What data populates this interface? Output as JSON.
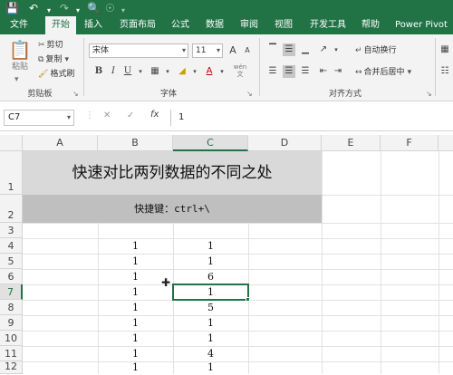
{
  "quick_access": {
    "save_icon": "save-icon",
    "undo_icon": "undo-icon",
    "redo_icon": "redo-icon",
    "preview_icon": "print-preview-icon"
  },
  "tabs": [
    "文件",
    "开始",
    "插入",
    "页面布局",
    "公式",
    "数据",
    "审阅",
    "视图",
    "开发工具",
    "帮助",
    "Power Pivot"
  ],
  "active_tab": "开始",
  "ribbon": {
    "clipboard": {
      "paste": "粘贴",
      "cut": "剪切",
      "copy": "复制",
      "format_painter": "格式刷",
      "label": "剪贴板"
    },
    "font": {
      "font_name": "宋体",
      "font_size": "11",
      "bold": "B",
      "italic": "I",
      "underline": "U",
      "grow": "A",
      "shrink": "A",
      "label": "字体",
      "wen": "wén"
    },
    "alignment": {
      "wrap_text": "自动换行",
      "merge_center": "合并后居中",
      "label": "对齐方式"
    }
  },
  "formula_bar": {
    "name_box": "C7",
    "fx": "fx",
    "formula": "1"
  },
  "columns": [
    "A",
    "B",
    "C",
    "D",
    "E",
    "F"
  ],
  "rows": [
    "1",
    "2",
    "3",
    "4",
    "5",
    "6",
    "7",
    "8",
    "9",
    "10",
    "11",
    "12"
  ],
  "sheet": {
    "title": "快速对比两列数据的不同之处",
    "shortcut": "快捷键：ctrl+\\",
    "col_b": [
      "1",
      "1",
      "1",
      "1",
      "1",
      "1",
      "1",
      "1",
      "1"
    ],
    "col_c": [
      "1",
      "1",
      "6",
      "1",
      "5",
      "1",
      "1",
      "4",
      "1"
    ]
  },
  "selected_cell": "C7",
  "accent_color": "#217346"
}
